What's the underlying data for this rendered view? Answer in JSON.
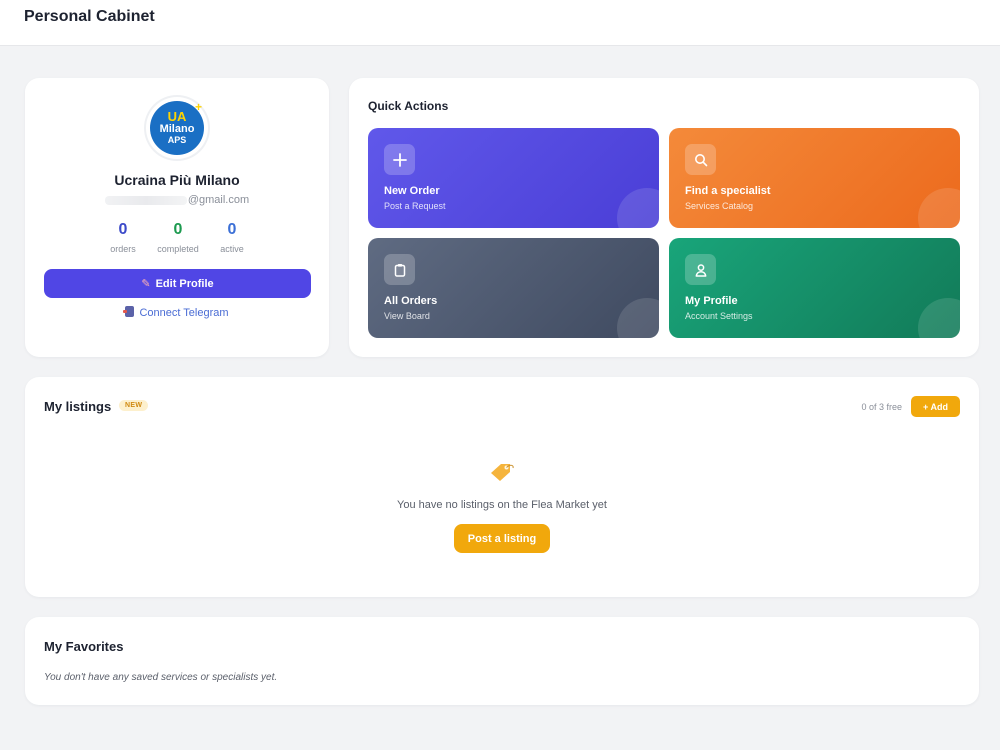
{
  "header": {
    "title": "Personal Cabinet"
  },
  "profile": {
    "avatar_logo": {
      "line1": "UA",
      "line2": "Milano",
      "line3": "APS",
      "plus": "+"
    },
    "name": "Ucraina Più Milano",
    "email_visible": "@gmail.com",
    "stats": [
      {
        "value": "0",
        "label": "orders",
        "color": "#3b49c9"
      },
      {
        "value": "0",
        "label": "completed",
        "color": "#1c9a4f"
      },
      {
        "value": "0",
        "label": "active",
        "color": "#3b6fd6"
      }
    ],
    "edit_button": "Edit Profile",
    "telegram_link": "Connect Telegram"
  },
  "quick_actions": {
    "title": "Quick Actions",
    "tiles": [
      {
        "title": "New Order",
        "subtitle": "Post a Request",
        "icon": "plus-icon",
        "color": "#5a51e8"
      },
      {
        "title": "Find a specialist",
        "subtitle": "Services Catalog",
        "icon": "search-icon",
        "color": "#f07a2a"
      },
      {
        "title": "All Orders",
        "subtitle": "View Board",
        "icon": "clipboard-icon",
        "color": "#525d74"
      },
      {
        "title": "My Profile",
        "subtitle": "Account Settings",
        "icon": "user-icon",
        "color": "#169066"
      }
    ]
  },
  "listings": {
    "title": "My listings",
    "badge": "NEW",
    "free_count": "0 of 3 free",
    "add_button": "+ Add",
    "empty_text": "You have no listings on the Flea Market yet",
    "post_button": "Post a listing",
    "accent": "#f1a80c"
  },
  "favorites": {
    "title": "My Favorites",
    "empty_text": "You don't have any saved services or specialists yet."
  }
}
